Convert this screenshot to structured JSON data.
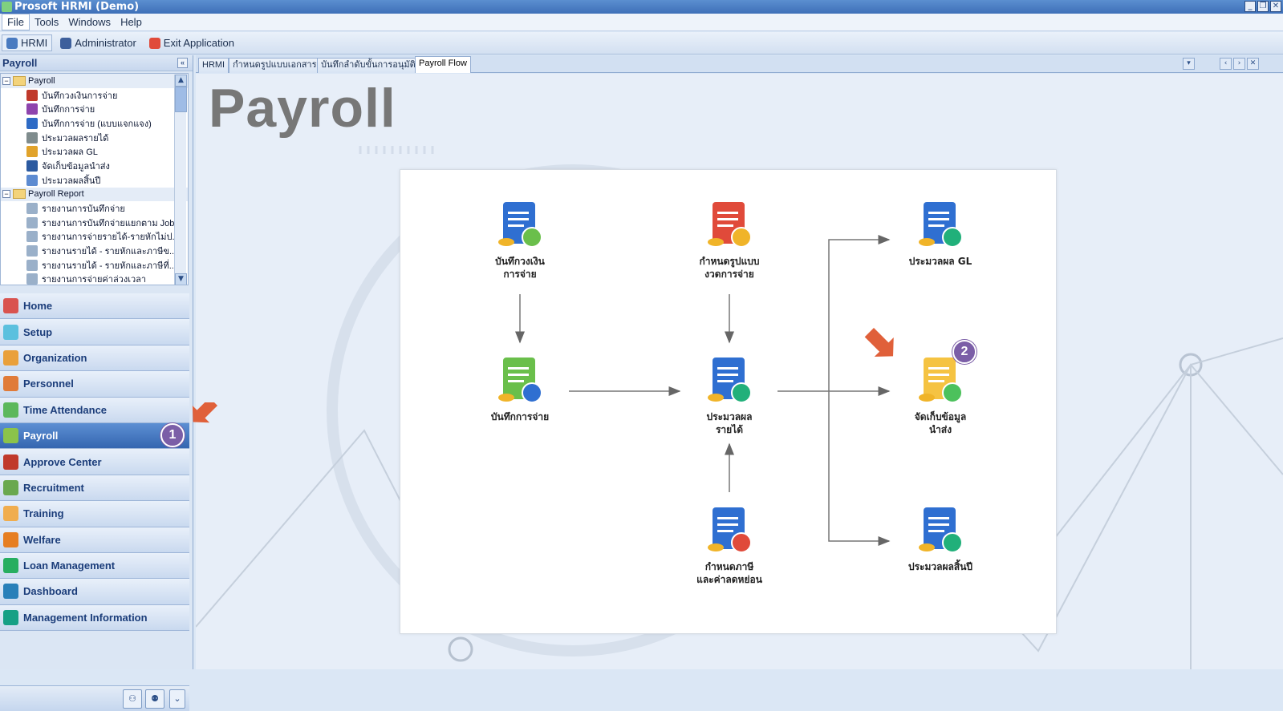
{
  "window": {
    "title": "Prosoft HRMI (Demo)"
  },
  "menu": [
    {
      "label": "File",
      "active": true
    },
    {
      "label": "Tools"
    },
    {
      "label": "Windows"
    },
    {
      "label": "Help"
    }
  ],
  "toolbar": [
    {
      "label": "HRMI",
      "icon": "hrmi-icon",
      "color": "#4a7bc0"
    },
    {
      "label": "Administrator",
      "icon": "admin-user-icon",
      "color": "#3d5f9c"
    },
    {
      "label": "Exit Application",
      "icon": "exit-icon",
      "color": "#e04a3a"
    }
  ],
  "sidebar": {
    "header": "Payroll",
    "tree": [
      {
        "label": "Payroll",
        "type": "root"
      },
      {
        "label": "บันทึกวงเงินการจ่าย",
        "type": "child",
        "color": "#c0392b"
      },
      {
        "label": "บันทึกการจ่าย",
        "type": "child",
        "color": "#8e44ad"
      },
      {
        "label": "บันทึกการจ่าย (แบบแจกแจง)",
        "type": "child",
        "color": "#2e6bc5"
      },
      {
        "label": "ประมวลผลรายได้",
        "type": "child",
        "color": "#7f8c8d"
      },
      {
        "label": "ประมวลผล GL",
        "type": "child",
        "color": "#e1a32b"
      },
      {
        "label": "จัดเก็บข้อมูลนำส่ง",
        "type": "child",
        "color": "#2c5aa0"
      },
      {
        "label": "ประมวลผลสิ้นปี",
        "type": "child",
        "color": "#5d8bd1"
      },
      {
        "label": "Payroll Report",
        "type": "root"
      },
      {
        "label": "รายงานการบันทึกจ่าย",
        "type": "child",
        "color": "#9ab0c9"
      },
      {
        "label": "รายงานการบันทึกจ่ายแยกตาม Job",
        "type": "child",
        "color": "#9ab0c9"
      },
      {
        "label": "รายงานการจ่ายรายได้-รายหักไม่ป...",
        "type": "child",
        "color": "#9ab0c9"
      },
      {
        "label": "รายงานรายได้ - รายหักและภาษีข...",
        "type": "child",
        "color": "#9ab0c9"
      },
      {
        "label": "รายงานรายได้ - รายหักและภาษีที่...",
        "type": "child",
        "color": "#9ab0c9"
      },
      {
        "label": "รายงานการจ่ายค่าล่วงเวลา",
        "type": "child",
        "color": "#9ab0c9"
      }
    ],
    "nav": [
      {
        "label": "Home",
        "icon": "home-icon",
        "color": "#d9534f"
      },
      {
        "label": "Setup",
        "icon": "setup-icon",
        "color": "#5bc0de"
      },
      {
        "label": "Organization",
        "icon": "organization-icon",
        "color": "#e9a03b"
      },
      {
        "label": "Personnel",
        "icon": "personnel-icon",
        "color": "#e07b39"
      },
      {
        "label": "Time Attendance",
        "icon": "time-attendance-icon",
        "color": "#5cb85c"
      },
      {
        "label": "Payroll",
        "icon": "payroll-icon",
        "color": "#8bc34a",
        "selected": true
      },
      {
        "label": "Approve Center",
        "icon": "approve-icon",
        "color": "#c0392b"
      },
      {
        "label": "Recruitment",
        "icon": "recruitment-icon",
        "color": "#6aa84f"
      },
      {
        "label": "Training",
        "icon": "training-icon",
        "color": "#f0ad4e"
      },
      {
        "label": "Welfare",
        "icon": "welfare-icon",
        "color": "#e67e22"
      },
      {
        "label": "Loan Management",
        "icon": "loan-icon",
        "color": "#27ae60"
      },
      {
        "label": "Dashboard",
        "icon": "dashboard-icon",
        "color": "#2980b9"
      },
      {
        "label": "Management Information",
        "icon": "management-info-icon",
        "color": "#16a085"
      }
    ]
  },
  "annotations": {
    "payroll_badge": "1",
    "flow_badge": "2",
    "arrow_color": "#e0603a",
    "badge_color": "#7b5ea7"
  },
  "tabs": [
    {
      "label": "HRMI"
    },
    {
      "label": "กำหนดรูปแบบเอกสาร"
    },
    {
      "label": "บันทึกลำดับขั้นการอนุมัติ"
    },
    {
      "label": "Payroll Flow",
      "active": true
    }
  ],
  "page": {
    "title": "Payroll"
  },
  "flow": {
    "nodes": [
      {
        "id": "n1",
        "label": "บันทึกวงเงิน\nการจ่าย",
        "icon": "document-money-icon"
      },
      {
        "id": "n2",
        "label": "กำหนดรูปแบบ\nงวดการจ่าย",
        "icon": "calendar-clock-icon"
      },
      {
        "id": "n3",
        "label": "ประมวลผล GL",
        "icon": "gl-calculator-icon"
      },
      {
        "id": "n4",
        "label": "บันทึกการจ่าย",
        "icon": "money-save-icon"
      },
      {
        "id": "n5",
        "label": "ประมวลผล\nรายได้",
        "icon": "process-income-icon"
      },
      {
        "id": "n6",
        "label": "จัดเก็บข้อมูล\nนำส่ง",
        "icon": "folder-export-icon"
      },
      {
        "id": "n7",
        "label": "กำหนดภาษี\nและค่าลดหย่อน",
        "icon": "tax-document-icon"
      },
      {
        "id": "n8",
        "label": "ประมวลผลสิ้นปี",
        "icon": "year-end-icon"
      }
    ]
  }
}
